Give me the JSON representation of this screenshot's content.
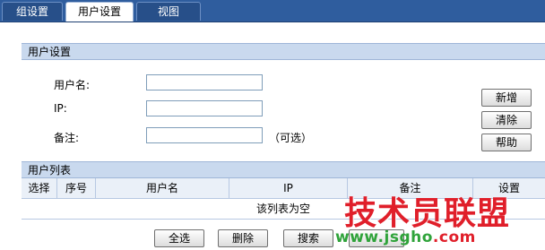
{
  "tabs": [
    "组设置",
    "用户设置",
    "视图"
  ],
  "user_settings": {
    "title": "用户设置",
    "username_label": "用户名:",
    "username_value": "",
    "ip_label": "IP:",
    "ip_value": "",
    "note_label": "备注:",
    "note_value": "",
    "optional_hint": "（可选）",
    "buttons": {
      "add": "新增",
      "clear": "清除",
      "help": "帮助"
    }
  },
  "user_list": {
    "title": "用户列表",
    "columns": [
      "选择",
      "序号",
      "用户名",
      "IP",
      "备注",
      "设置"
    ],
    "empty_message": "该列表为空"
  },
  "actions": {
    "select_all": "全选",
    "delete": "删除",
    "search": "搜索",
    "extra": ""
  },
  "watermark": {
    "main": "技术员联盟",
    "url_prefix": "www.",
    "url_mid": "jsgho",
    "url_suffix": ".com"
  },
  "colors": {
    "tab_bg": "#2f5d9e",
    "section_bg": "#c9d9ee",
    "watermark_red": "#e01f2a",
    "watermark_green": "#2fa33a"
  }
}
